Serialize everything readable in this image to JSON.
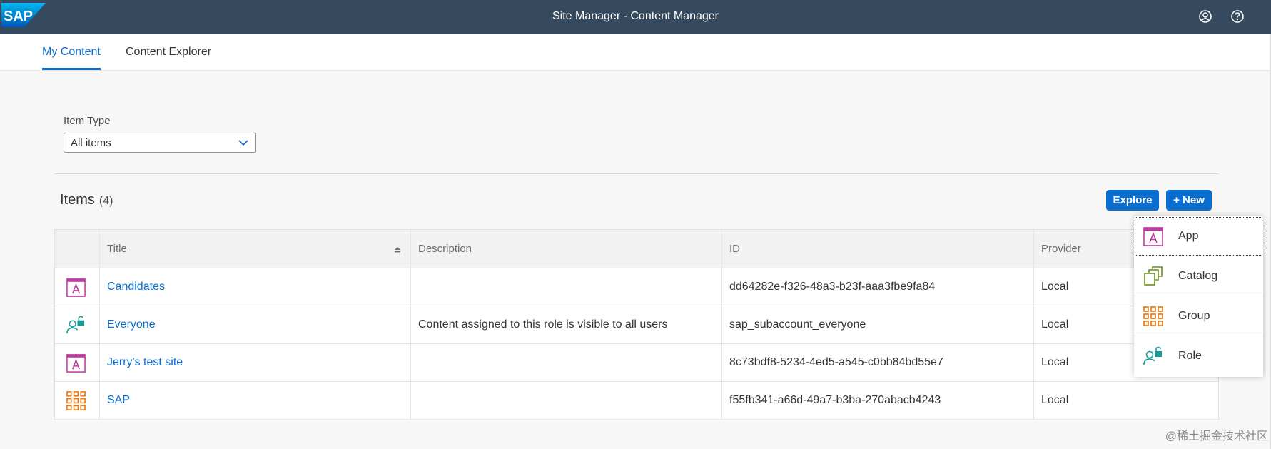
{
  "shell": {
    "logo_text": "SAP",
    "title": "Site Manager - Content Manager",
    "profile_icon": "profile-icon",
    "help_icon": "help-icon"
  },
  "tabs": [
    {
      "label": "My Content",
      "active": true
    },
    {
      "label": "Content Explorer",
      "active": false
    }
  ],
  "filter": {
    "label": "Item Type",
    "value": "All items"
  },
  "items_section": {
    "title": "Items",
    "count": "(4)",
    "explore_label": "Explore",
    "new_label": "+ New"
  },
  "table": {
    "columns": [
      "Title",
      "Description",
      "ID",
      "Provider"
    ],
    "rows": [
      {
        "icon": "app-icon",
        "title": "Candidates",
        "description": "",
        "id": "dd64282e-f326-48a3-b23f-aaa3fbe9fa84",
        "provider": "Local"
      },
      {
        "icon": "role-icon",
        "title": "Everyone",
        "description": "Content assigned to this role is visible to all users",
        "id": "sap_subaccount_everyone",
        "provider": "Local"
      },
      {
        "icon": "app-icon",
        "title": "Jerry's test site",
        "description": "",
        "id": "8c73bdf8-5234-4ed5-a545-c0bb84bd55e7",
        "provider": "Local"
      },
      {
        "icon": "group-icon",
        "title": "SAP",
        "description": "",
        "id": "f55fb341-a66d-49a7-b3ba-270abacb4243",
        "provider": "Local"
      }
    ]
  },
  "new_menu": {
    "items": [
      {
        "icon": "app-icon",
        "label": "App"
      },
      {
        "icon": "catalog-icon",
        "label": "Catalog"
      },
      {
        "icon": "group-icon",
        "label": "Group"
      },
      {
        "icon": "role-icon",
        "label": "Role"
      }
    ]
  },
  "colors": {
    "shell": "#354a5f",
    "accent": "#0a6ed1",
    "app_icon": "#c0399f",
    "role_icon": "#1a9898",
    "group_icon": "#e9730c",
    "catalog_icon": "#6c8f1a"
  },
  "watermark": "@稀土掘金技术社区"
}
